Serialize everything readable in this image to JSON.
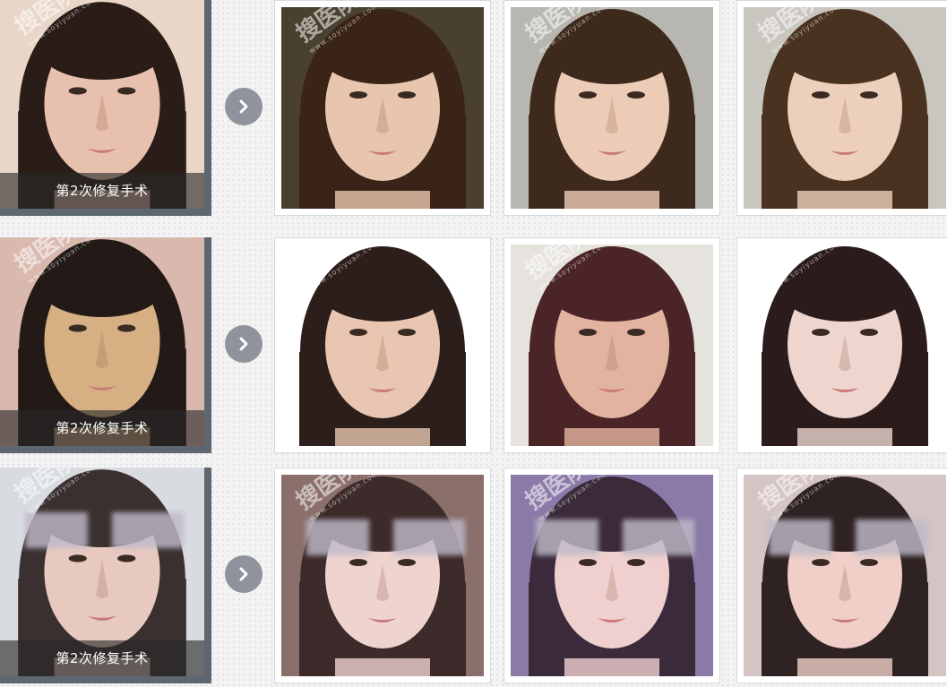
{
  "watermark": {
    "brand": "搜医院",
    "url": "www.soyiyuan.com"
  },
  "colors": {
    "before_frame": "#5e6770",
    "arrow": "#8f939c",
    "caption_bg": "rgba(40,40,40,0.62)"
  },
  "arrow_icon": "chevron-right-icon",
  "rows": [
    {
      "before": {
        "caption": "第2次修复手术",
        "bg": "#e9d6c8",
        "hair": "#2a1c16",
        "skin": "#e8c1ae"
      },
      "after": [
        {
          "bg": "#4a4030",
          "hair": "#3a2418",
          "skin": "#e7c6ad"
        },
        {
          "bg": "#b8b6b0",
          "hair": "#3e2a1c",
          "skin": "#ecccb6"
        },
        {
          "bg": "#c9c6c0",
          "hair": "#4a3220",
          "skin": "#ecd0bb"
        }
      ]
    },
    {
      "before": {
        "caption": "第2次修复手术",
        "bg": "#d9b9ae",
        "hair": "#231a18",
        "skin": "#d6b083"
      },
      "after": [
        {
          "bg": "#ffffff",
          "hair": "#2c1e1a",
          "skin": "#e9c6b1"
        },
        {
          "bg": "#e6e3de",
          "hair": "#4a2426",
          "skin": "#e2b4a0"
        },
        {
          "bg": "#ffffff",
          "hair": "#2b1b1b",
          "skin": "#eed6cf"
        }
      ]
    },
    {
      "before": {
        "caption": "第2次修复手术",
        "bg": "#d8dbe0",
        "hair": "#3a3030",
        "skin": "#e8c9c0",
        "blur": true
      },
      "after": [
        {
          "bg": "#8a6f6a",
          "hair": "#3d2a2a",
          "skin": "#efd3cf",
          "blur": true
        },
        {
          "bg": "#8b7aa8",
          "hair": "#3a2a3a",
          "skin": "#efd0cf",
          "blur": true
        },
        {
          "bg": "#d4c4c4",
          "hair": "#2e2222",
          "skin": "#efcfc8",
          "blur": true
        }
      ]
    }
  ]
}
